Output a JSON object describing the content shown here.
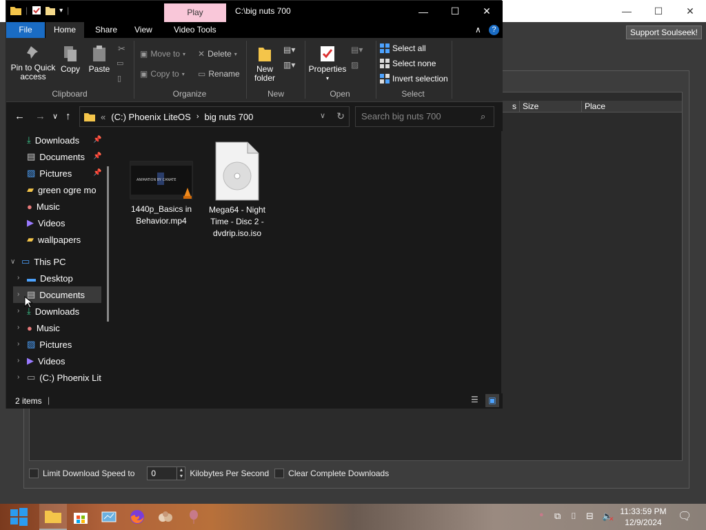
{
  "background_app": {
    "support_button": "Support Soulseek!",
    "columns": [
      "s",
      "Size",
      "Place"
    ],
    "limit_label": "Limit Download Speed to",
    "speed_value": "0",
    "speed_unit": "Kilobytes Per Second",
    "clear_label": "Clear Complete Downloads"
  },
  "explorer": {
    "title": "C:\\big nuts 700",
    "play_tab": "Play",
    "tabs": {
      "file": "File",
      "home": "Home",
      "share": "Share",
      "view": "View",
      "video_tools": "Video Tools"
    },
    "ribbon": {
      "pin": "Pin to Quick access",
      "copy": "Copy",
      "paste": "Paste",
      "move_to": "Move to",
      "copy_to": "Copy to",
      "delete": "Delete",
      "rename": "Rename",
      "new_folder": "New folder",
      "properties": "Properties",
      "select_all": "Select all",
      "select_none": "Select none",
      "invert_selection": "Invert selection",
      "groups": {
        "clipboard": "Clipboard",
        "organize": "Organize",
        "new": "New",
        "open": "Open",
        "select": "Select"
      }
    },
    "address": {
      "prefix": "«",
      "drive": "(C:) Phoenix LiteOS",
      "folder": "big nuts 700"
    },
    "search_placeholder": "Search big nuts 700",
    "nav": {
      "quick": [
        "Downloads",
        "Documents",
        "Pictures",
        "green ogre mo",
        "Music",
        "Videos",
        "wallpapers"
      ],
      "this_pc": "This PC",
      "pc_items": [
        "Desktop",
        "Documents",
        "Downloads",
        "Music",
        "Pictures",
        "Videos",
        "(C:) Phoenix Lit"
      ]
    },
    "files": [
      {
        "name": "1440p_Basics in Behavior.mp4",
        "thumb_text": "ANIMATION BY CANATE"
      },
      {
        "name": "Mega64 - Night Time - Disc 2 - dvdrip.iso.iso"
      }
    ],
    "status": "2 items"
  },
  "clock": {
    "time": "11:33:59 PM",
    "date": "12/9/2024"
  },
  "colors": {
    "accent": "#1a6cc4",
    "play_tab": "#f9c7d9"
  }
}
